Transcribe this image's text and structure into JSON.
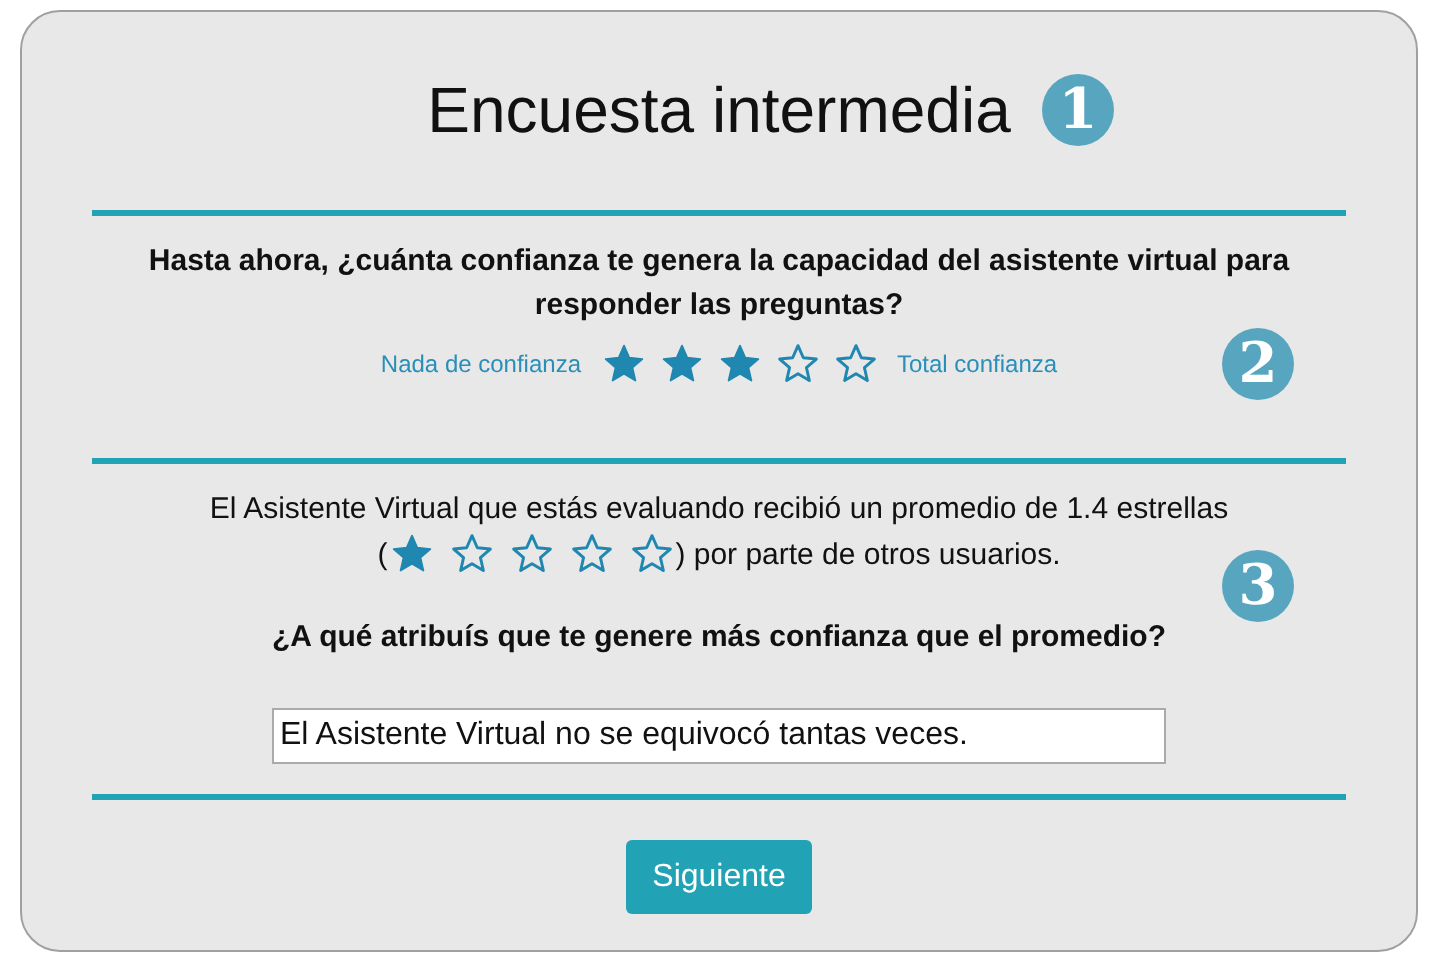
{
  "title": "Encuesta intermedia",
  "sections": [
    {
      "badge": "1"
    },
    {
      "badge": "2",
      "question": "Hasta ahora, ¿cuánta confianza te genera la capacidad del asistente virtual para responder las preguntas?",
      "low_label": "Nada de confianza",
      "high_label": "Total confianza",
      "stars": 3
    },
    {
      "badge": "3",
      "average_text": "El Asistente Virtual que estás evaluando recibió un promedio de 1.4 estrellas",
      "open_paren": "(",
      "stars": 1,
      "close_text": ") por parte de otros usuarios.",
      "question": "¿A qué atribuís que te genere más confianza que el promedio?",
      "answer": "El Asistente Virtual no se equivocó tantas veces."
    }
  ],
  "button": "Siguiente"
}
